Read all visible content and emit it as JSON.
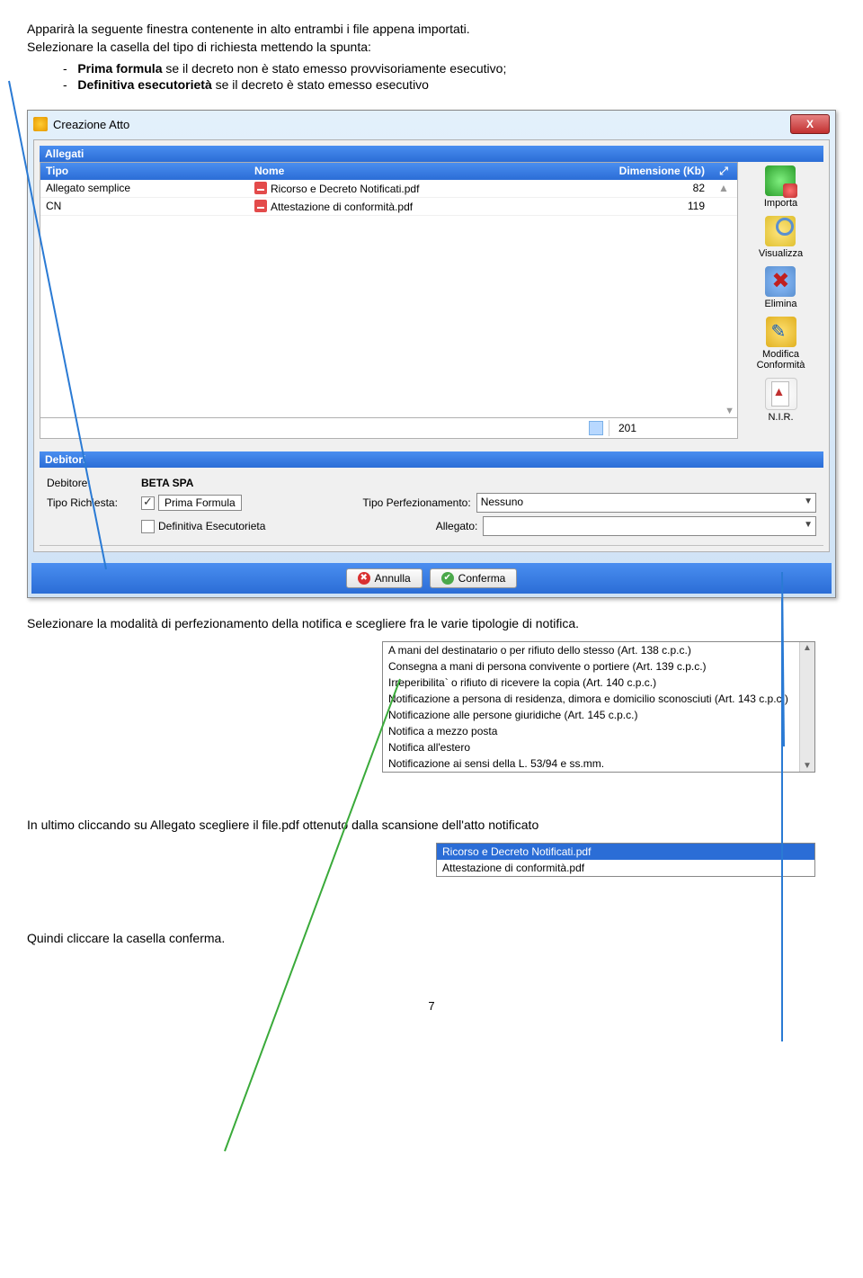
{
  "intro": {
    "line1": "Apparirà la seguente finestra contenente in alto entrambi i file appena importati.",
    "line2": "Selezionare la casella del tipo di richiesta mettendo la spunta:"
  },
  "bullets": {
    "b1_prefix": "-",
    "b1_strong": "Prima formula",
    "b1_rest": " se il decreto non è stato emesso provvisoriamente esecutivo;",
    "b2_prefix": "-",
    "b2_strong": "Definitiva esecutorietà",
    "b2_rest": " se il decreto è stato emesso esecutivo"
  },
  "window": {
    "title": "Creazione Atto",
    "close": "X"
  },
  "allegati": {
    "header": "Allegati",
    "cols": {
      "tipo": "Tipo",
      "nome": "Nome",
      "dim": "Dimensione (Kb)",
      "expand": "⤢"
    },
    "rows": [
      {
        "tipo": "Allegato semplice",
        "nome": "Ricorso e Decreto Notificati.pdf",
        "dim": "82"
      },
      {
        "tipo": "CN",
        "nome": "Attestazione di conformità.pdf",
        "dim": "119"
      }
    ],
    "status_total": "201"
  },
  "side": {
    "importa": "Importa",
    "visualizza": "Visualizza",
    "elimina": "Elimina",
    "modifica": "Modifica Conformità",
    "nir": "N.I.R."
  },
  "debitori": {
    "header": "Debitori",
    "lbl_debitore": "Debitore:",
    "debitore": "BETA SPA",
    "lbl_tipo": "Tipo Richiesta:",
    "prima": "Prima Formula",
    "lbl_perf": "Tipo Perfezionamento:",
    "perf_val": "Nessuno",
    "definitiva": "Definitiva Esecutorieta",
    "lbl_allegato": "Allegato:",
    "allegato_val": ""
  },
  "buttons": {
    "annulla": "Annulla",
    "conferma": "Conferma"
  },
  "mid1": "Selezionare la modalità di perfezionamento della notifica e scegliere fra le varie tipologie di notifica.",
  "dropdown": [
    "A mani del destinatario o per rifiuto dello stesso (Art. 138 c.p.c.)",
    "Consegna a mani di persona convivente o portiere (Art. 139 c.p.c.)",
    "Irreperibilita` o rifiuto di ricevere la copia (Art. 140 c.p.c.)",
    "Notificazione a persona di residenza, dimora e domicilio sconosciuti (Art. 143 c.p.c.)",
    "Notificazione alle persone giuridiche (Art. 145 c.p.c.)",
    "Notifica a mezzo posta",
    "Notifica all'estero",
    "Notificazione ai sensi della L. 53/94 e ss.mm."
  ],
  "mid2": "In ultimo cliccando su Allegato scegliere il file.pdf ottenuto dalla scansione dell'atto notificato",
  "files": {
    "selected": "Ricorso e Decreto Notificati.pdf",
    "other": "Attestazione di conformità.pdf"
  },
  "final": "Quindi cliccare la casella conferma.",
  "page": "7"
}
